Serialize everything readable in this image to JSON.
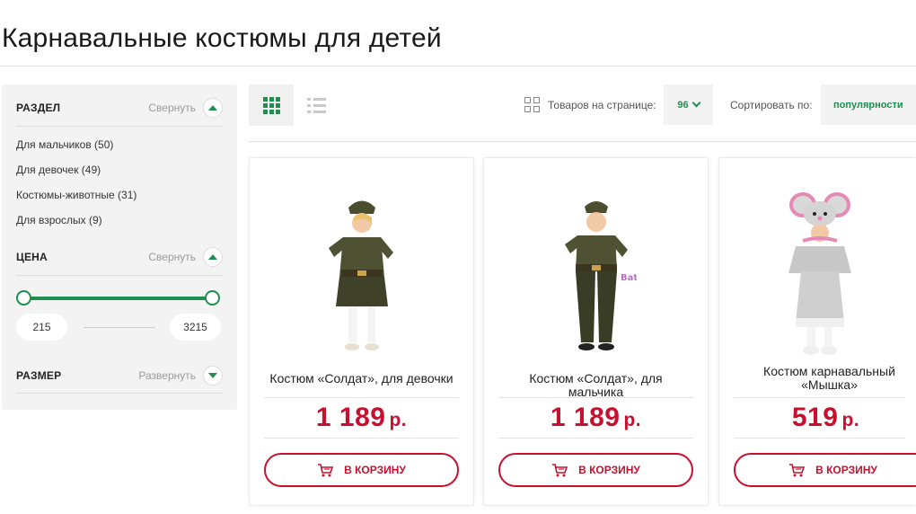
{
  "page": {
    "title": "Карнавальные костюмы для детей"
  },
  "filters": {
    "section": {
      "title": "РАЗДЕЛ",
      "toggle": "Свернуть",
      "items": [
        "Для мальчиков (50)",
        "Для девочек (49)",
        "Костюмы-животные (31)",
        "Для взрослых (9)"
      ]
    },
    "price": {
      "title": "ЦЕНА",
      "toggle": "Свернуть",
      "min": "215",
      "max": "3215"
    },
    "size": {
      "title": "РАЗМЕР",
      "toggle": "Развернуть"
    }
  },
  "toolbar": {
    "per_page_label": "Товаров на странице:",
    "per_page_value": "96",
    "sort_label": "Сортировать по:",
    "sort_value": "популярности"
  },
  "products": [
    {
      "name": "Костюм «Солдат», для девочки",
      "price": "1 189",
      "currency": "р.",
      "button": "В КОРЗИНУ",
      "image": "girl-soldier-costume"
    },
    {
      "name": "Костюм «Солдат», для мальчика",
      "price": "1 189",
      "currency": "р.",
      "button": "В КОРЗИНУ",
      "image": "boy-soldier-costume"
    },
    {
      "name": "Костюм карнавальный «Мышка»",
      "price": "519",
      "currency": "р.",
      "button": "В КОРЗИНУ",
      "image": "mouse-costume"
    }
  ],
  "colors": {
    "accent": "#1e8f4f",
    "price": "#c8102e"
  },
  "icons": [
    "grid-view-icon",
    "list-view-icon",
    "per-page-icon",
    "chevron-down-icon",
    "chevron-up-icon",
    "cart-icon"
  ]
}
